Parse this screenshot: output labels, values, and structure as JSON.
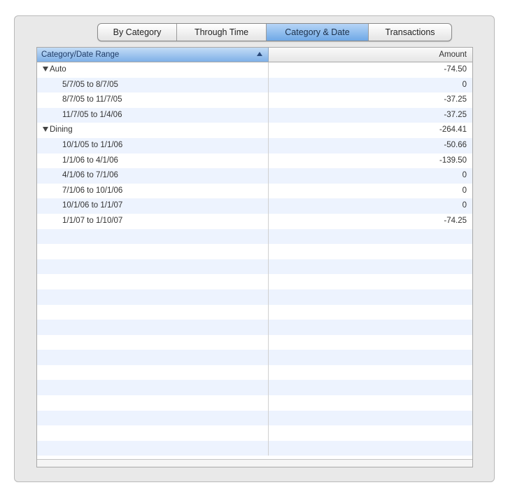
{
  "tabs": [
    {
      "label": "By Category",
      "active": false
    },
    {
      "label": "Through Time",
      "active": false
    },
    {
      "label": "Category & Date",
      "active": true
    },
    {
      "label": "Transactions",
      "active": false
    }
  ],
  "table": {
    "columns": [
      "Category/Date Range",
      "Amount"
    ],
    "sort_column": "Category/Date Range",
    "sort_direction": "ascending",
    "groups": [
      {
        "label": "Auto",
        "expanded": true,
        "amount": "-74.50",
        "rows": [
          {
            "range": "5/7/05 to 8/7/05",
            "amount": "0"
          },
          {
            "range": "8/7/05 to 11/7/05",
            "amount": "-37.25"
          },
          {
            "range": "11/7/05 to 1/4/06",
            "amount": "-37.25"
          }
        ]
      },
      {
        "label": "Dining",
        "expanded": true,
        "amount": "-264.41",
        "rows": [
          {
            "range": "10/1/05 to 1/1/06",
            "amount": "-50.66"
          },
          {
            "range": "1/1/06 to 4/1/06",
            "amount": "-139.50"
          },
          {
            "range": "4/1/06 to 7/1/06",
            "amount": "0"
          },
          {
            "range": "7/1/06 to 10/1/06",
            "amount": "0"
          },
          {
            "range": "10/1/06 to 1/1/07",
            "amount": "0"
          },
          {
            "range": "1/1/07 to 1/10/07",
            "amount": "-74.25"
          }
        ]
      }
    ]
  },
  "colors": {
    "selection_blue": "#7fb0e7",
    "alt_row": "#edf3fe",
    "panel_bg": "#e9e9e9"
  },
  "icons": [
    "sort-ascending-icon",
    "disclosure-triangle-icon"
  ]
}
